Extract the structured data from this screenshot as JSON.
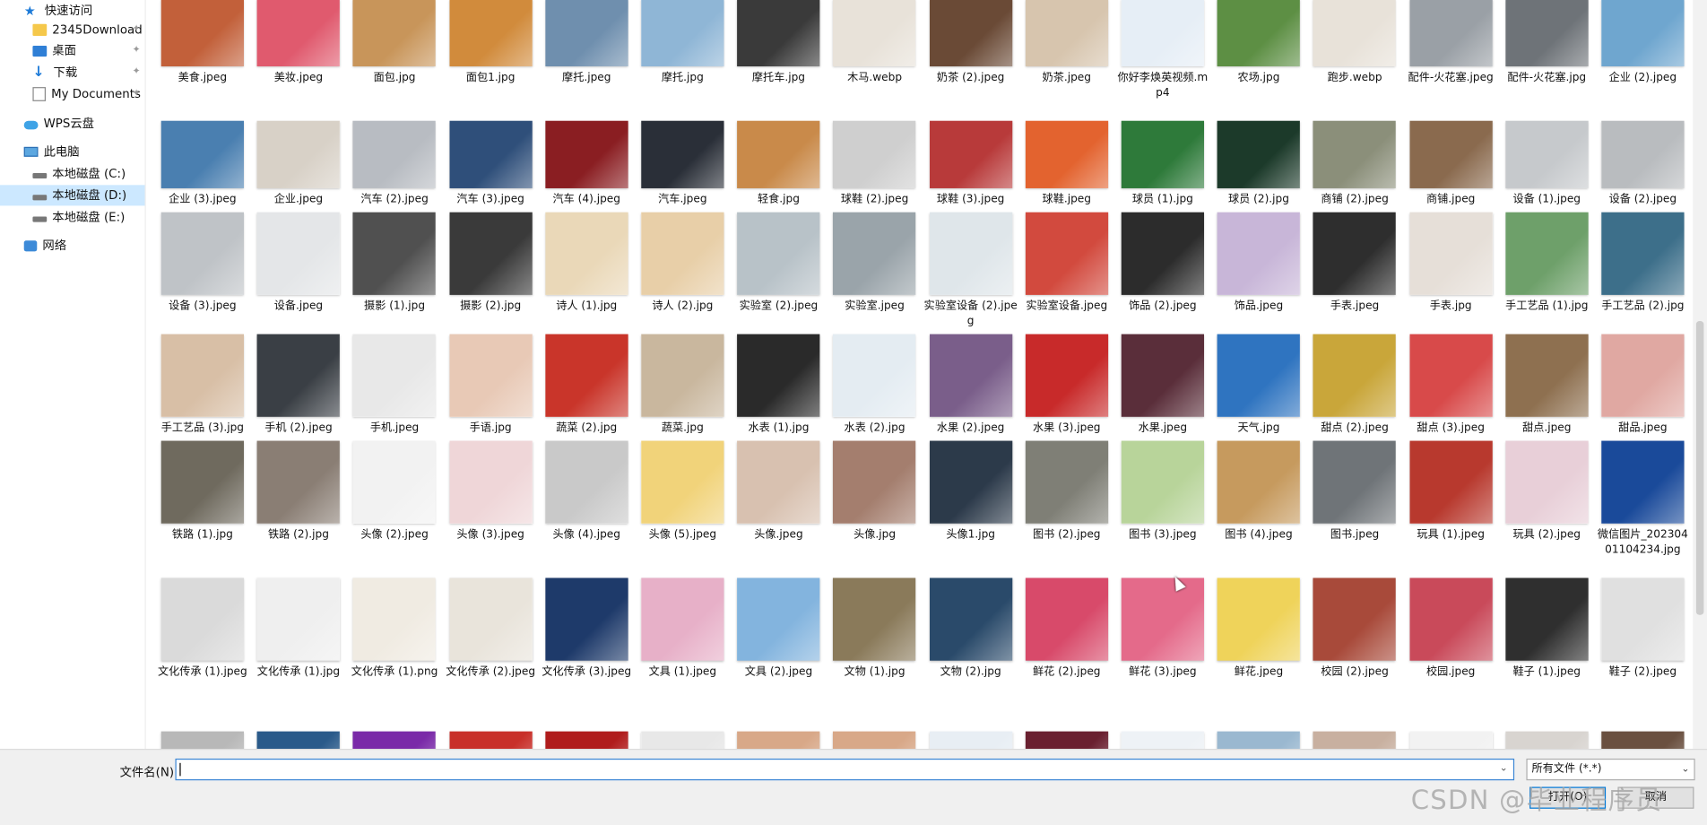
{
  "sidebar": {
    "items": [
      {
        "label": "快速访问",
        "icon": "star-icon",
        "pinned": false
      },
      {
        "label": "2345Download",
        "icon": "folder-icon",
        "pinned": true
      },
      {
        "label": "桌面",
        "icon": "desktop-icon",
        "pinned": true
      },
      {
        "label": "下载",
        "icon": "download-icon",
        "pinned": true
      },
      {
        "label": "My Documents",
        "icon": "document-icon",
        "pinned": true
      },
      {
        "label": "WPS云盘",
        "icon": "cloud-icon",
        "pinned": false
      },
      {
        "label": "此电脑",
        "icon": "computer-icon",
        "pinned": false
      },
      {
        "label": "本地磁盘 (C:)",
        "icon": "drive-icon",
        "pinned": false
      },
      {
        "label": "本地磁盘 (D:)",
        "icon": "drive-icon",
        "pinned": false,
        "selected": true
      },
      {
        "label": "本地磁盘 (E:)",
        "icon": "drive-icon",
        "pinned": false
      },
      {
        "label": "网络",
        "icon": "network-icon",
        "pinned": false
      }
    ],
    "pin_glyph": "✦"
  },
  "rows": [
    {
      "files": [
        "美食.jpeg",
        "美妆.jpeg",
        "面包.jpg",
        "面包1.jpg",
        "摩托.jpeg",
        "摩托.jpg",
        "摩托车.jpg",
        "木马.webp",
        "奶茶 (2).jpeg",
        "奶茶.jpeg",
        "你好李焕英视频.mp4",
        "农场.jpg",
        "跑步.webp",
        "配件-火花塞.jpeg",
        "配件-火花塞.jpg",
        "企业 (2).jpeg"
      ]
    },
    {
      "files": [
        "企业 (3).jpeg",
        "企业.jpeg",
        "汽车 (2).jpeg",
        "汽车 (3).jpeg",
        "汽车 (4).jpeg",
        "汽车.jpeg",
        "轻食.jpg",
        "球鞋 (2).jpeg",
        "球鞋 (3).jpeg",
        "球鞋.jpeg",
        "球员 (1).jpg",
        "球员 (2).jpg",
        "商铺 (2).jpeg",
        "商铺.jpeg",
        "设备 (1).jpeg",
        "设备 (2).jpeg"
      ]
    },
    {
      "files": [
        "设备 (3).jpeg",
        "设备.jpeg",
        "摄影 (1).jpg",
        "摄影 (2).jpg",
        "诗人 (1).jpg",
        "诗人 (2).jpg",
        "实验室 (2).jpeg",
        "实验室.jpeg",
        "实验室设备 (2).jpeg",
        "实验室设备.jpeg",
        "饰品 (2).jpeg",
        "饰品.jpeg",
        "手表.jpeg",
        "手表.jpg",
        "手工艺品 (1).jpg",
        "手工艺品 (2).jpg"
      ]
    },
    {
      "files": [
        "手工艺品 (3).jpg",
        "手机 (2).jpeg",
        "手机.jpeg",
        "手语.jpg",
        "蔬菜 (2).jpg",
        "蔬菜.jpg",
        "水表 (1).jpg",
        "水表 (2).jpg",
        "水果 (2).jpeg",
        "水果 (3).jpeg",
        "水果.jpeg",
        "天气.jpg",
        "甜点 (2).jpeg",
        "甜点 (3).jpeg",
        "甜点.jpeg",
        "甜品.jpeg"
      ]
    },
    {
      "files": [
        "铁路 (1).jpg",
        "铁路 (2).jpg",
        "头像 (2).jpeg",
        "头像 (3).jpeg",
        "头像 (4).jpeg",
        "头像 (5).jpeg",
        "头像.jpeg",
        "头像.jpg",
        "头像1.jpg",
        "图书 (2).jpeg",
        "图书 (3).jpeg",
        "图书 (4).jpeg",
        "图书.jpeg",
        "玩具 (1).jpeg",
        "玩具 (2).jpeg",
        "微信图片_20230401104234.jpg"
      ]
    },
    {
      "files": [
        "文化传承 (1).jpeg",
        "文化传承 (1).jpg",
        "文化传承 (1).png",
        "文化传承 (2).jpeg",
        "文化传承 (3).jpeg",
        "文具 (1).jpeg",
        "文具 (2).jpeg",
        "文物 (1).jpg",
        "文物 (2).jpg",
        "鲜花 (2).jpeg",
        "鲜花 (3).jpeg",
        "鲜花.jpeg",
        "校园 (2).jpeg",
        "校园.jpeg",
        "鞋子 (1).jpeg",
        "鞋子 (2).jpeg"
      ]
    },
    {
      "files": [
        "",
        "",
        "",
        "",
        "",
        "",
        "",
        "",
        "",
        "",
        "",
        "",
        "",
        "",
        "",
        ""
      ]
    }
  ],
  "thumb_colors": [
    [
      "#c2603a",
      "#e05a6e",
      "#c8955a",
      "#d18b3c",
      "#6f8fae",
      "#8fb6d6",
      "#3a3a3a",
      "#e8e2d9",
      "#6a4a36",
      "#d7c5ae",
      "#e6eef6",
      "#5d8f44",
      "#e8e2d9",
      "#9aa0a6",
      "#6e7378",
      "#6fa6cf"
    ],
    [
      "#4a7fb0",
      "#d8d1c7",
      "#b8bcc2",
      "#2f4f7a",
      "#8a1e22",
      "#2a2f38",
      "#c98a4a",
      "#cfcfcf",
      "#b83a3a",
      "#e3632f",
      "#2e7a3a",
      "#1c3a2a",
      "#8b8f7a",
      "#8a6a4e",
      "#c6c9cc",
      "#b9bcbf"
    ],
    [
      "#bfc3c7",
      "#e4e6e8",
      "#505050",
      "#3a3a3a",
      "#ead8b8",
      "#e8cfa8",
      "#b8c2c8",
      "#9aa4aa",
      "#dfe6ea",
      "#d24a3e",
      "#2c2c2c",
      "#c8b6d8",
      "#2e2e2e",
      "#e6dfd8",
      "#6ea06a",
      "#3d6f8a"
    ],
    [
      "#d8bfa6",
      "#3a3f45",
      "#e8e8e8",
      "#e8c9b6",
      "#c9352a",
      "#c9b79e",
      "#2a2a2a",
      "#e4ecf2",
      "#7a5e8a",
      "#c82a2a",
      "#5a2e3a",
      "#2f74c0",
      "#c9a63a",
      "#d84a4a",
      "#8e7050",
      "#e0a8a2"
    ],
    [
      "#6f6a5e",
      "#8a7e74",
      "#f2f2f2",
      "#efd6d8",
      "#c9c9c9",
      "#f1d37a",
      "#d8c1b0",
      "#a47e6e",
      "#2c3a4a",
      "#7f7f76",
      "#b8d49a",
      "#c69a5e",
      "#6f7478",
      "#b8392e",
      "#e8cfd8",
      "#1a4a9a"
    ],
    [
      "#dadada",
      "#efefef",
      "#f0ebe2",
      "#e9e4db",
      "#1e3a6a",
      "#e7b0c8",
      "#83b4de",
      "#8a7a5a",
      "#2a4a6a",
      "#d84a6a",
      "#e46a8a",
      "#efd35a",
      "#a84a3a",
      "#c94a5a",
      "#2f2f2f",
      "#e0e0e0"
    ],
    [
      "#b8b8b8",
      "#2a5a8a",
      "#7a2aa8",
      "#c8302a",
      "#b01c1c",
      "#e8e8e8",
      "#d8a888",
      "#d8a888",
      "#e8eef4",
      "#6a2030",
      "#eef2f6",
      "#9ab8d0",
      "#c8b0a0",
      "#f2f2f2",
      "#d8d4d0",
      "#6a5040"
    ]
  ],
  "filename_label": "文件名(N):",
  "filename_value": "",
  "filetype_value": "所有文件 (*.*)",
  "open_button": "打开(O)",
  "cancel_button": "取消",
  "watermark": "CSDN @毕业程序员"
}
